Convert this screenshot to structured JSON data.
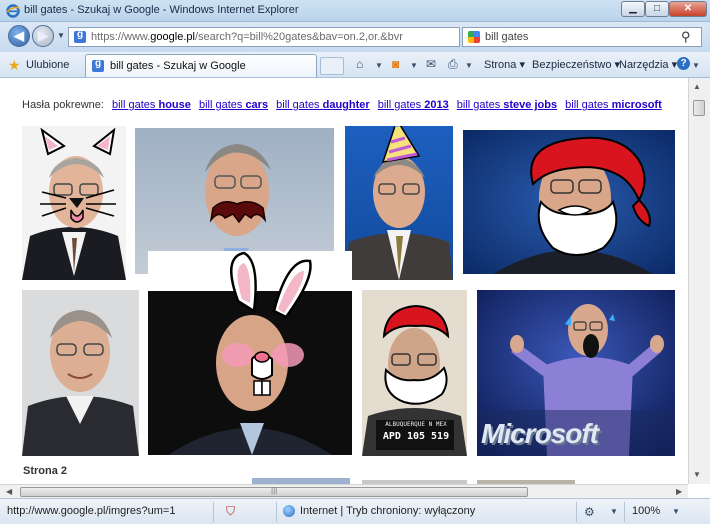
{
  "window": {
    "title": "bill gates - Szukaj w Google - Windows Internet Explorer",
    "min_glyph": "▁",
    "max_glyph": "□",
    "close_glyph": "✕"
  },
  "nav": {
    "address": "https://www.google.pl/search?q=bill%20gates&bav=on.2,or.&bvr",
    "address_host_prefix": "https://www.",
    "address_host": "google.pl",
    "address_path": "/search?q=bill%20gates&bav=on.2,or.&bvr",
    "search_value": "bill gates",
    "back_glyph": "◀",
    "forward_glyph": "▶",
    "refresh_glyph": "⟳",
    "stop_glyph": "✕",
    "search_glyph": "⚲"
  },
  "favbar": {
    "favorites_label": "Ulubione",
    "tab_title": "bill gates - Szukaj w Google",
    "commands": [
      {
        "label": "Strona ▾"
      },
      {
        "label": "Bezpieczeństwo ▾"
      },
      {
        "label": "Narzędzia ▾"
      }
    ]
  },
  "content": {
    "related_label": "Hasła pokrewne:",
    "related": [
      {
        "plain": "bill gates ",
        "bold": "house"
      },
      {
        "plain": "bill gates ",
        "bold": "cars"
      },
      {
        "plain": "bill gates ",
        "bold": "daughter"
      },
      {
        "plain": "bill gates ",
        "bold": "2013"
      },
      {
        "plain": "bill gates ",
        "bold": "steve jobs"
      },
      {
        "plain": "bill gates ",
        "bold": "microsoft"
      }
    ],
    "mugshot_line1": "ALBUQUERQUE  N MEX",
    "mugshot_line2": "APD  105 519",
    "logo_text": "Microsoft",
    "page_label": "Strona 2"
  },
  "status": {
    "url": "http://www.google.pl/imgres?um=1",
    "zone": "Internet | Tryb chroniony: wyłączony",
    "zoom": "100%"
  },
  "colors": {
    "link": "#2200cc",
    "chrome": "#c7daef"
  }
}
